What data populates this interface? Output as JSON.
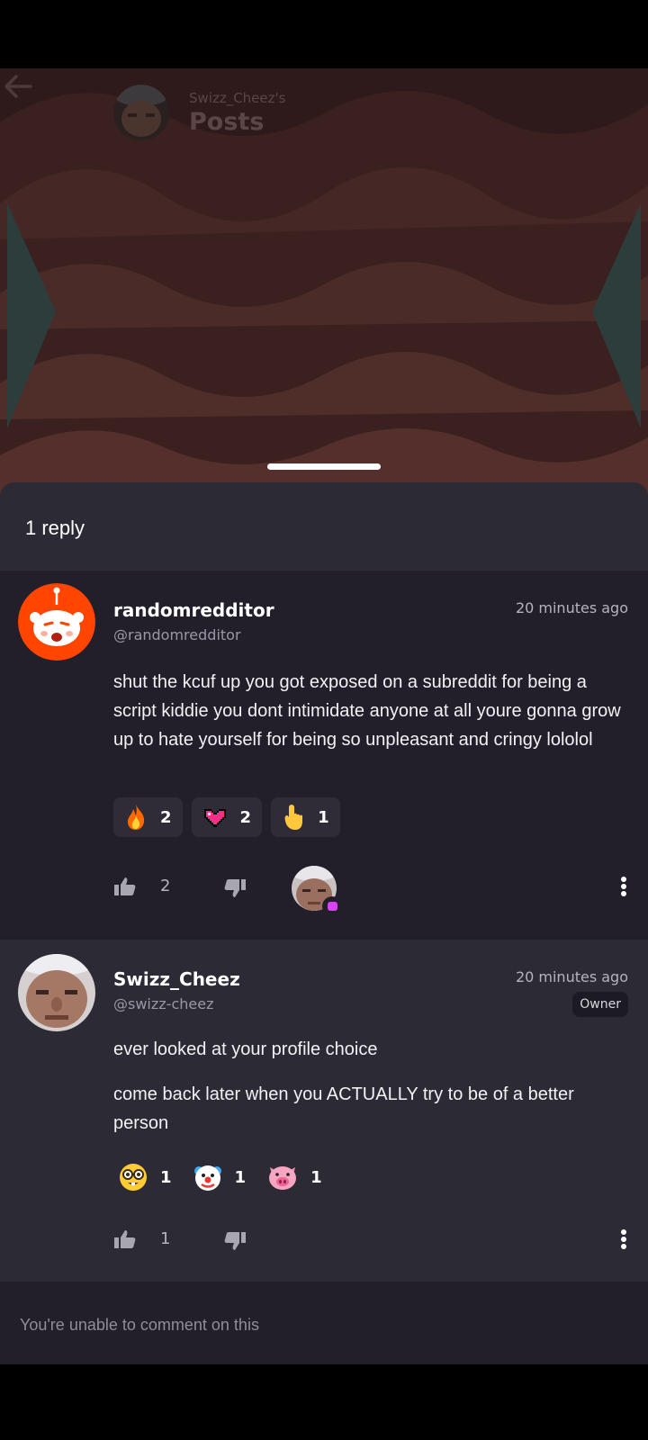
{
  "header": {
    "subtitle": "Swizz_Cheez's",
    "title": "Posts"
  },
  "sheet": {
    "reply_count": "1 reply"
  },
  "comments": [
    {
      "name": "randomredditor",
      "handle": "@randomredditor",
      "time": "20 minutes ago",
      "body": "shut the kcuf up you got exposed on a subreddit for being a script kiddie you dont intimidate anyone at all youre gonna grow up to hate yourself for being so unpleasant and cringy lololol",
      "reactions": [
        {
          "icon": "fire-icon",
          "count": "2"
        },
        {
          "icon": "pixel-heart-icon",
          "count": "2"
        },
        {
          "icon": "pointing-finger-icon",
          "count": "1"
        }
      ],
      "upvotes": "2"
    },
    {
      "name": "Swizz_Cheez",
      "handle": "@swizz-cheez",
      "time": "20 minutes ago",
      "badge": "Owner",
      "paragraphs": [
        "ever looked at your profile choice",
        "come back later when you ACTUALLY try to be of a better person"
      ],
      "reactions": [
        {
          "icon": "nerd-face-icon",
          "count": "1"
        },
        {
          "icon": "clown-face-icon",
          "count": "1"
        },
        {
          "icon": "pig-face-icon",
          "count": "1"
        }
      ],
      "upvotes": "1"
    }
  ],
  "footer": {
    "message": "You're unable to comment on this"
  },
  "colors": {
    "sheet_bg": "#2c2a35",
    "comment_bg": "#221f2a",
    "reddit_orange": "#ff4500",
    "accent_pink": "#e040fb"
  }
}
